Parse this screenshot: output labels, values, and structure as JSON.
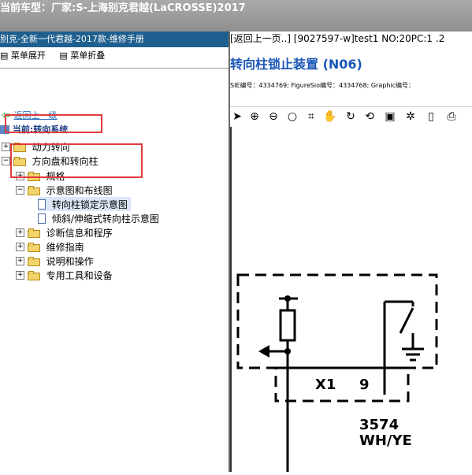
{
  "topbar": {
    "title": "当前车型：厂家:S-上海别克君越(LaCROSSE)2017"
  },
  "left": {
    "title": "别克-全新一代君越-2017款-维修手册",
    "tools": [
      {
        "label": "菜单展开"
      },
      {
        "label": "菜单折叠"
      }
    ],
    "back_label": "返回上一级",
    "current_label": "当前:转向系统",
    "tree": [
      {
        "label": "动力转向"
      },
      {
        "label": "方向盘和转向柱"
      },
      {
        "label": "规格"
      },
      {
        "label": "示意图和布线图"
      },
      {
        "label": "转向柱锁定示意图"
      },
      {
        "label": "倾斜/伸缩式转向柱示意图"
      },
      {
        "label": "诊断信息和程序"
      },
      {
        "label": "维修指南"
      },
      {
        "label": "说明和操作"
      },
      {
        "label": "专用工具和设备"
      }
    ]
  },
  "right": {
    "nav": "[返回上一页..] [9027597-w]test1 NO:20PC:1 .2",
    "title": "转向柱锁止装置 (N06)",
    "meta": "SIE编号：4334769;  FigureSio编号：4334768;  Graphic编号：",
    "diagram": {
      "connector_label": "X1",
      "pin_label": "9",
      "wire_number": "3574",
      "wire_color": "WH/YE"
    }
  },
  "icons": {
    "toolbar": [
      "pointer-icon",
      "zoom-in-icon",
      "zoom-out-icon",
      "zoom-search-icon",
      "crop-icon",
      "pan-hand-icon",
      "rotate-icon",
      "reset-icon",
      "fit-icon",
      "settings-icon",
      "page-icon",
      "print-icon"
    ]
  }
}
